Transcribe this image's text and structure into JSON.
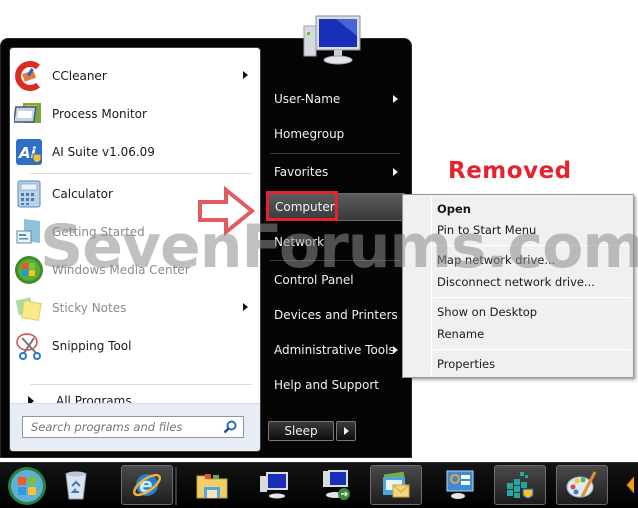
{
  "annotation": {
    "label": "Removed",
    "watermark": "SevenForums.com",
    "accent_color": "#e5232e"
  },
  "start_menu": {
    "pinned_programs": [
      {
        "label": "CCleaner",
        "icon": "ccleaner-icon",
        "has_submenu": true,
        "dim": false
      },
      {
        "label": "Process Monitor",
        "icon": "process-monitor-icon",
        "has_submenu": false,
        "dim": false
      },
      {
        "label": "AI Suite v1.06.09",
        "icon": "ai-suite-icon",
        "has_submenu": false,
        "dim": false
      }
    ],
    "recent_programs": [
      {
        "label": "Calculator",
        "icon": "calculator-icon",
        "has_submenu": false,
        "dim": false
      },
      {
        "label": "Getting Started",
        "icon": "getting-started-icon",
        "has_submenu": false,
        "dim": true
      },
      {
        "label": "Windows Media Center",
        "icon": "windows-media-center-icon",
        "has_submenu": false,
        "dim": true
      },
      {
        "label": "Sticky Notes",
        "icon": "sticky-notes-icon",
        "has_submenu": true,
        "dim": true
      },
      {
        "label": "Snipping Tool",
        "icon": "snipping-tool-icon",
        "has_submenu": false,
        "dim": false
      }
    ],
    "all_programs_label": "All Programs",
    "search": {
      "placeholder": "Search programs and files",
      "value": ""
    },
    "right_items": [
      {
        "label": "User-Name",
        "has_submenu": true
      },
      {
        "label": "Homegroup",
        "has_submenu": false
      },
      {
        "label": "Favorites",
        "has_submenu": true
      },
      {
        "label": "Computer",
        "has_submenu": false,
        "highlighted": true
      },
      {
        "label": "Network",
        "has_submenu": false
      },
      {
        "label": "Control Panel",
        "has_submenu": false
      },
      {
        "label": "Devices and Printers",
        "has_submenu": false
      },
      {
        "label": "Administrative Tools",
        "has_submenu": true
      },
      {
        "label": "Help and Support",
        "has_submenu": false
      }
    ],
    "power_button_label": "Sleep"
  },
  "context_menu": {
    "items": [
      {
        "label": "Open",
        "bold": true
      },
      {
        "label": "Pin to Start Menu",
        "bold": false
      },
      {
        "label": "Map network drive...",
        "bold": false
      },
      {
        "label": "Disconnect network drive...",
        "bold": false
      },
      {
        "label": "Show on Desktop",
        "bold": false
      },
      {
        "label": "Rename",
        "bold": false
      },
      {
        "label": "Properties",
        "bold": false
      }
    ]
  },
  "taskbar": {
    "items": [
      {
        "name": "start-button",
        "icon": "windows-orb-icon"
      },
      {
        "name": "recycle-bin",
        "icon": "recycle-bin-icon"
      },
      {
        "name": "internet-explorer",
        "icon": "internet-explorer-icon",
        "active": true
      },
      {
        "name": "windows-explorer",
        "icon": "folder-icon"
      },
      {
        "name": "computer",
        "icon": "computer-icon"
      },
      {
        "name": "remote-desktop",
        "icon": "remote-desktop-icon"
      },
      {
        "name": "windows-mail",
        "icon": "mail-icon",
        "active": true
      },
      {
        "name": "control-panel",
        "icon": "control-panel-icon"
      },
      {
        "name": "windows-update",
        "icon": "windows-update-icon",
        "active": true
      },
      {
        "name": "paint",
        "icon": "paint-icon",
        "active": true
      }
    ]
  }
}
